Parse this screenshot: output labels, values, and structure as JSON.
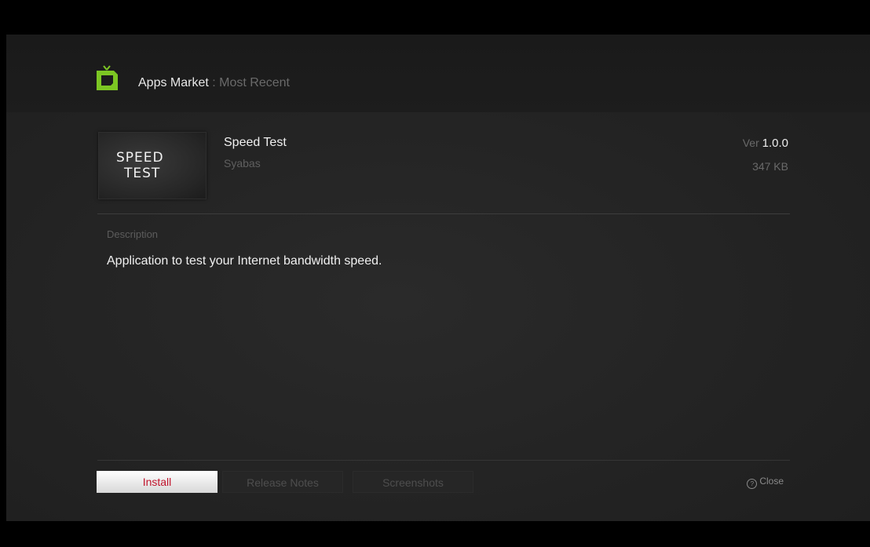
{
  "header": {
    "title": "Apps Market",
    "separator": " : ",
    "subtitle": "Most Recent"
  },
  "app": {
    "icon_line1": "SPEED",
    "icon_line2": "TEST",
    "name": "Speed Test",
    "author": "Syabas",
    "version_label": "Ver ",
    "version": "1.0.0",
    "size": "347 KB"
  },
  "description": {
    "label": "Description",
    "text": "Application to test your Internet bandwidth speed."
  },
  "buttons": {
    "install": "Install",
    "release_notes": "Release Notes",
    "screenshots": "Screenshots",
    "close": "Close"
  },
  "icons": {
    "logo": "tv-logo-icon",
    "close": "close-icon"
  },
  "colors": {
    "logo_green": "#7cc623",
    "install_text": "#c0142c",
    "background": "#242424"
  }
}
